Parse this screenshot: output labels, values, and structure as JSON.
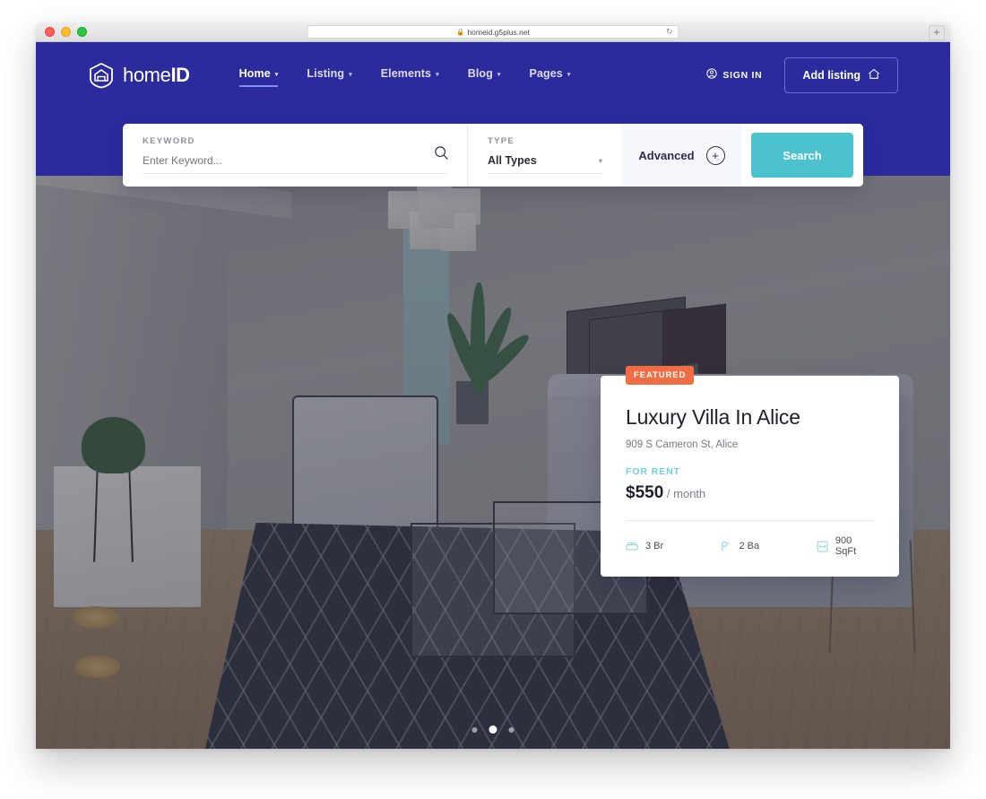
{
  "browser": {
    "url": "homeid.g5plus.net",
    "lock_icon": "lock-icon",
    "reload_icon": "reload-icon",
    "new_tab_label": "+"
  },
  "navbar": {
    "logo": {
      "text_light": "home",
      "text_bold": "ID",
      "icon": "home-shield-icon"
    },
    "links": [
      {
        "label": "Home",
        "caret": "▾",
        "active": true
      },
      {
        "label": "Listing",
        "caret": "▾",
        "active": false
      },
      {
        "label": "Elements",
        "caret": "▾",
        "active": false
      },
      {
        "label": "Blog",
        "caret": "▾",
        "active": false
      },
      {
        "label": "Pages",
        "caret": "▾",
        "active": false
      }
    ],
    "sign_in": {
      "label": "SIGN IN",
      "icon": "user-circle-icon"
    },
    "add_listing": {
      "label": "Add listing",
      "icon": "home-icon"
    }
  },
  "search_panel": {
    "keyword": {
      "label": "KEYWORD",
      "placeholder": "Enter Keyword...",
      "value": "",
      "icon": "search-icon"
    },
    "type": {
      "label": "TYPE",
      "selected": "All Types",
      "caret": "▾"
    },
    "advanced": {
      "label": "Advanced",
      "icon": "plus-circle-icon"
    },
    "search_button": {
      "label": "Search",
      "color": "#4cc2ce"
    }
  },
  "property_card": {
    "badge": "FEATURED",
    "badge_color": "#ef6d45",
    "title": "Luxury Villa In Alice",
    "address": "909 S Cameron St, Alice",
    "status": "FOR RENT",
    "status_color": "#6fd0d8",
    "price": "$550",
    "price_period": "/ month",
    "features": [
      {
        "value": "3 Br",
        "icon": "bed-icon"
      },
      {
        "value": "2 Ba",
        "icon": "bath-icon"
      },
      {
        "value": "900 SqFt",
        "icon": "area-icon"
      }
    ]
  },
  "carousel": {
    "total": 3,
    "active_index": 1
  },
  "theme": {
    "brand_blue": "#2b2b9e",
    "accent_teal": "#4cc2ce",
    "accent_orange": "#ef6d45"
  }
}
